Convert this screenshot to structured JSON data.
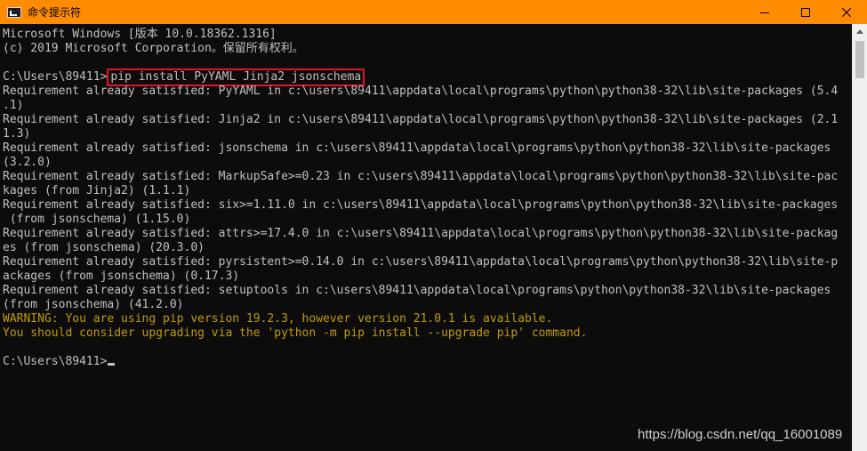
{
  "window": {
    "title": "命令提示符",
    "icon": "cmd-icon",
    "accent": "#ff8c00"
  },
  "controls": {
    "minimize_icon": "minimize-icon",
    "maximize_icon": "maximize-icon",
    "close_icon": "close-icon"
  },
  "console": {
    "lines": [
      {
        "text": "Microsoft Windows [版本 10.0.18362.1316]",
        "type": "normal"
      },
      {
        "text": "(c) 2019 Microsoft Corporation。保留所有权利。",
        "type": "normal"
      },
      {
        "text": "",
        "type": "normal"
      },
      {
        "prompt": "C:\\Users\\89411>",
        "command": "pip install PyYAML Jinja2 jsonschema",
        "type": "command"
      },
      {
        "text": "Requirement already satisfied: PyYAML in c:\\users\\89411\\appdata\\local\\programs\\python\\python38-32\\lib\\site-packages (5.4",
        "type": "normal"
      },
      {
        "text": ".1)",
        "type": "normal"
      },
      {
        "text": "Requirement already satisfied: Jinja2 in c:\\users\\89411\\appdata\\local\\programs\\python\\python38-32\\lib\\site-packages (2.1",
        "type": "normal"
      },
      {
        "text": "1.3)",
        "type": "normal"
      },
      {
        "text": "Requirement already satisfied: jsonschema in c:\\users\\89411\\appdata\\local\\programs\\python\\python38-32\\lib\\site-packages",
        "type": "normal"
      },
      {
        "text": "(3.2.0)",
        "type": "normal"
      },
      {
        "text": "Requirement already satisfied: MarkupSafe>=0.23 in c:\\users\\89411\\appdata\\local\\programs\\python\\python38-32\\lib\\site-pac",
        "type": "normal"
      },
      {
        "text": "kages (from Jinja2) (1.1.1)",
        "type": "normal"
      },
      {
        "text": "Requirement already satisfied: six>=1.11.0 in c:\\users\\89411\\appdata\\local\\programs\\python\\python38-32\\lib\\site-packages",
        "type": "normal"
      },
      {
        "text": " (from jsonschema) (1.15.0)",
        "type": "normal"
      },
      {
        "text": "Requirement already satisfied: attrs>=17.4.0 in c:\\users\\89411\\appdata\\local\\programs\\python\\python38-32\\lib\\site-packag",
        "type": "normal"
      },
      {
        "text": "es (from jsonschema) (20.3.0)",
        "type": "normal"
      },
      {
        "text": "Requirement already satisfied: pyrsistent>=0.14.0 in c:\\users\\89411\\appdata\\local\\programs\\python\\python38-32\\lib\\site-p",
        "type": "normal"
      },
      {
        "text": "ackages (from jsonschema) (0.17.3)",
        "type": "normal"
      },
      {
        "text": "Requirement already satisfied: setuptools in c:\\users\\89411\\appdata\\local\\programs\\python\\python38-32\\lib\\site-packages",
        "type": "normal"
      },
      {
        "text": "(from jsonschema) (41.2.0)",
        "type": "normal"
      },
      {
        "text": "WARNING: You are using pip version 19.2.3, however version 21.0.1 is available.",
        "type": "warning"
      },
      {
        "text": "You should consider upgrading via the 'python -m pip install --upgrade pip' command.",
        "type": "warning"
      },
      {
        "text": "",
        "type": "normal"
      },
      {
        "prompt": "C:\\Users\\89411>",
        "type": "current"
      }
    ],
    "text_color": "#c0c0c0",
    "warning_color": "#c19c00",
    "highlight_color": "#e81123"
  },
  "watermark": "https://blog.csdn.net/qq_16001089"
}
